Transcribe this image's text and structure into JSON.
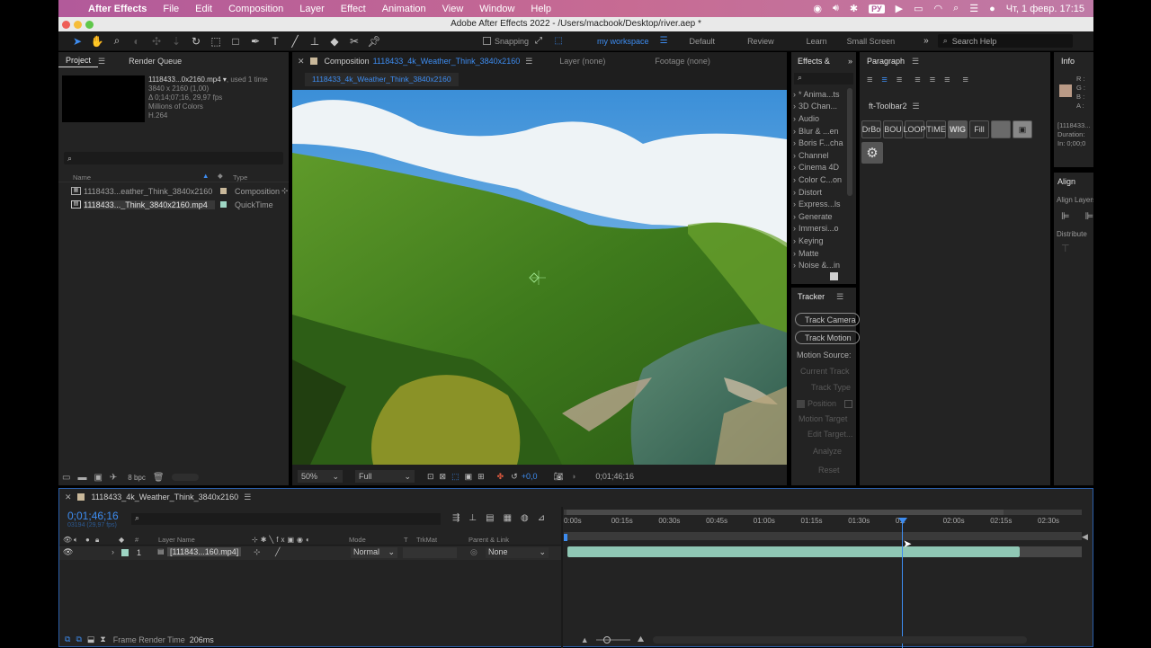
{
  "menubar": {
    "apple": "",
    "app_name": "After Effects",
    "items": [
      "File",
      "Edit",
      "Composition",
      "Layer",
      "Effect",
      "Animation",
      "View",
      "Window",
      "Help"
    ],
    "lang": "РУ",
    "clock": "Чт, 1 февр.  17:15"
  },
  "window_title": "Adobe After Effects 2022 - /Users/macbook/Desktop/river.aep *",
  "toolbar": {
    "snapping_label": "Snapping",
    "workspaces": [
      "my workspace",
      "Default",
      "Review",
      "Learn",
      "Small Screen"
    ],
    "active_workspace": "my workspace",
    "search_placeholder": "Search Help"
  },
  "project": {
    "tabs": [
      "Project",
      "Render Queue"
    ],
    "selected_name": "1118433...0x2160.mp4",
    "used_text": ", used 1 time",
    "info_lines": [
      "3840 x 2160 (1,00)",
      "Δ 0;14;07;16, 29,97 fps",
      "Millions of Colors",
      "H.264"
    ],
    "search_placeholder": "",
    "col_name": "Name",
    "col_type": "Type",
    "items": [
      {
        "name": "1118433...eather_Think_3840x2160",
        "type": "Composition",
        "kind": "comp",
        "swatch": "#c9b89a"
      },
      {
        "name": "1118433..._Think_3840x2160.mp4",
        "type": "QuickTime",
        "kind": "footage",
        "swatch": "#9ed6c4"
      }
    ],
    "bpc": "8 bpc"
  },
  "viewer": {
    "tab_prefix": "Composition",
    "comp_name": "1118433_4k_Weather_Think_3840x2160",
    "layer_tab": "Layer (none)",
    "footage_tab": "Footage (none)",
    "breadcrumb": "1118433_4k_Weather_Think_3840x2160",
    "zoom": "50%",
    "resolution": "Full",
    "exposure": "+0,0",
    "timecode": "0;01;46;16"
  },
  "effects": {
    "tab": "Effects &",
    "search_placeholder": "",
    "items": [
      "* Anima...ts",
      "3D Chan...",
      "Audio",
      "Blur & ...en",
      "Boris F...cha",
      "Channel",
      "Cinema 4D",
      "Color C...on",
      "Distort",
      "Express...ls",
      "Generate",
      "Immersi...o",
      "Keying",
      "Matte",
      "Noise &...in"
    ]
  },
  "tracker": {
    "title": "Tracker",
    "track_camera": "Track Camera",
    "track_motion": "Track Motion",
    "motion_source": "Motion Source:",
    "current_track": "Current Track",
    "track_type": "Track Type",
    "position": "Position",
    "motion_target": "Motion Target",
    "edit_target": "Edit Target...",
    "analyze": "Analyze",
    "reset": "Reset"
  },
  "paragraph": {
    "title": "Paragraph",
    "ft_title": "ft-Toolbar2",
    "ft_buttons": [
      "DrBo",
      "BOU",
      "LOOP",
      "TIME",
      "WIG",
      "Fill",
      "",
      ""
    ]
  },
  "info": {
    "title": "Info",
    "r": "R :",
    "g": "G :",
    "b": "B :",
    "a": "A :",
    "lines": [
      "[1118433...",
      "Duration:",
      "In: 0;00;0"
    ]
  },
  "align": {
    "title": "Align",
    "align_layers": "Align Layers",
    "distribute": "Distribute"
  },
  "timeline": {
    "comp_tab": "1118433_4k_Weather_Think_3840x2160",
    "timecode": "0;01;46;16",
    "frame_info": "03194 (29,97 fps)",
    "search_placeholder": "",
    "headers": {
      "num": "#",
      "layer_name": "Layer Name",
      "mode": "Mode",
      "t": "T",
      "trkmat": "TrkMat",
      "parent": "Parent & Link"
    },
    "ticks": [
      "0:00s",
      "00:15s",
      "00:30s",
      "00:45s",
      "01:00s",
      "01:15s",
      "01:30s",
      "01:",
      "02:00s",
      "02:15s",
      "02:30s"
    ],
    "playhead_seconds": 106.5,
    "layers": [
      {
        "index": "1",
        "name": "[111843...160.mp4]",
        "mode": "Normal",
        "parent": "None",
        "color": "#9ed6c4"
      }
    ],
    "frame_render_label": "Frame Render Time",
    "frame_render_value": "206ms"
  }
}
